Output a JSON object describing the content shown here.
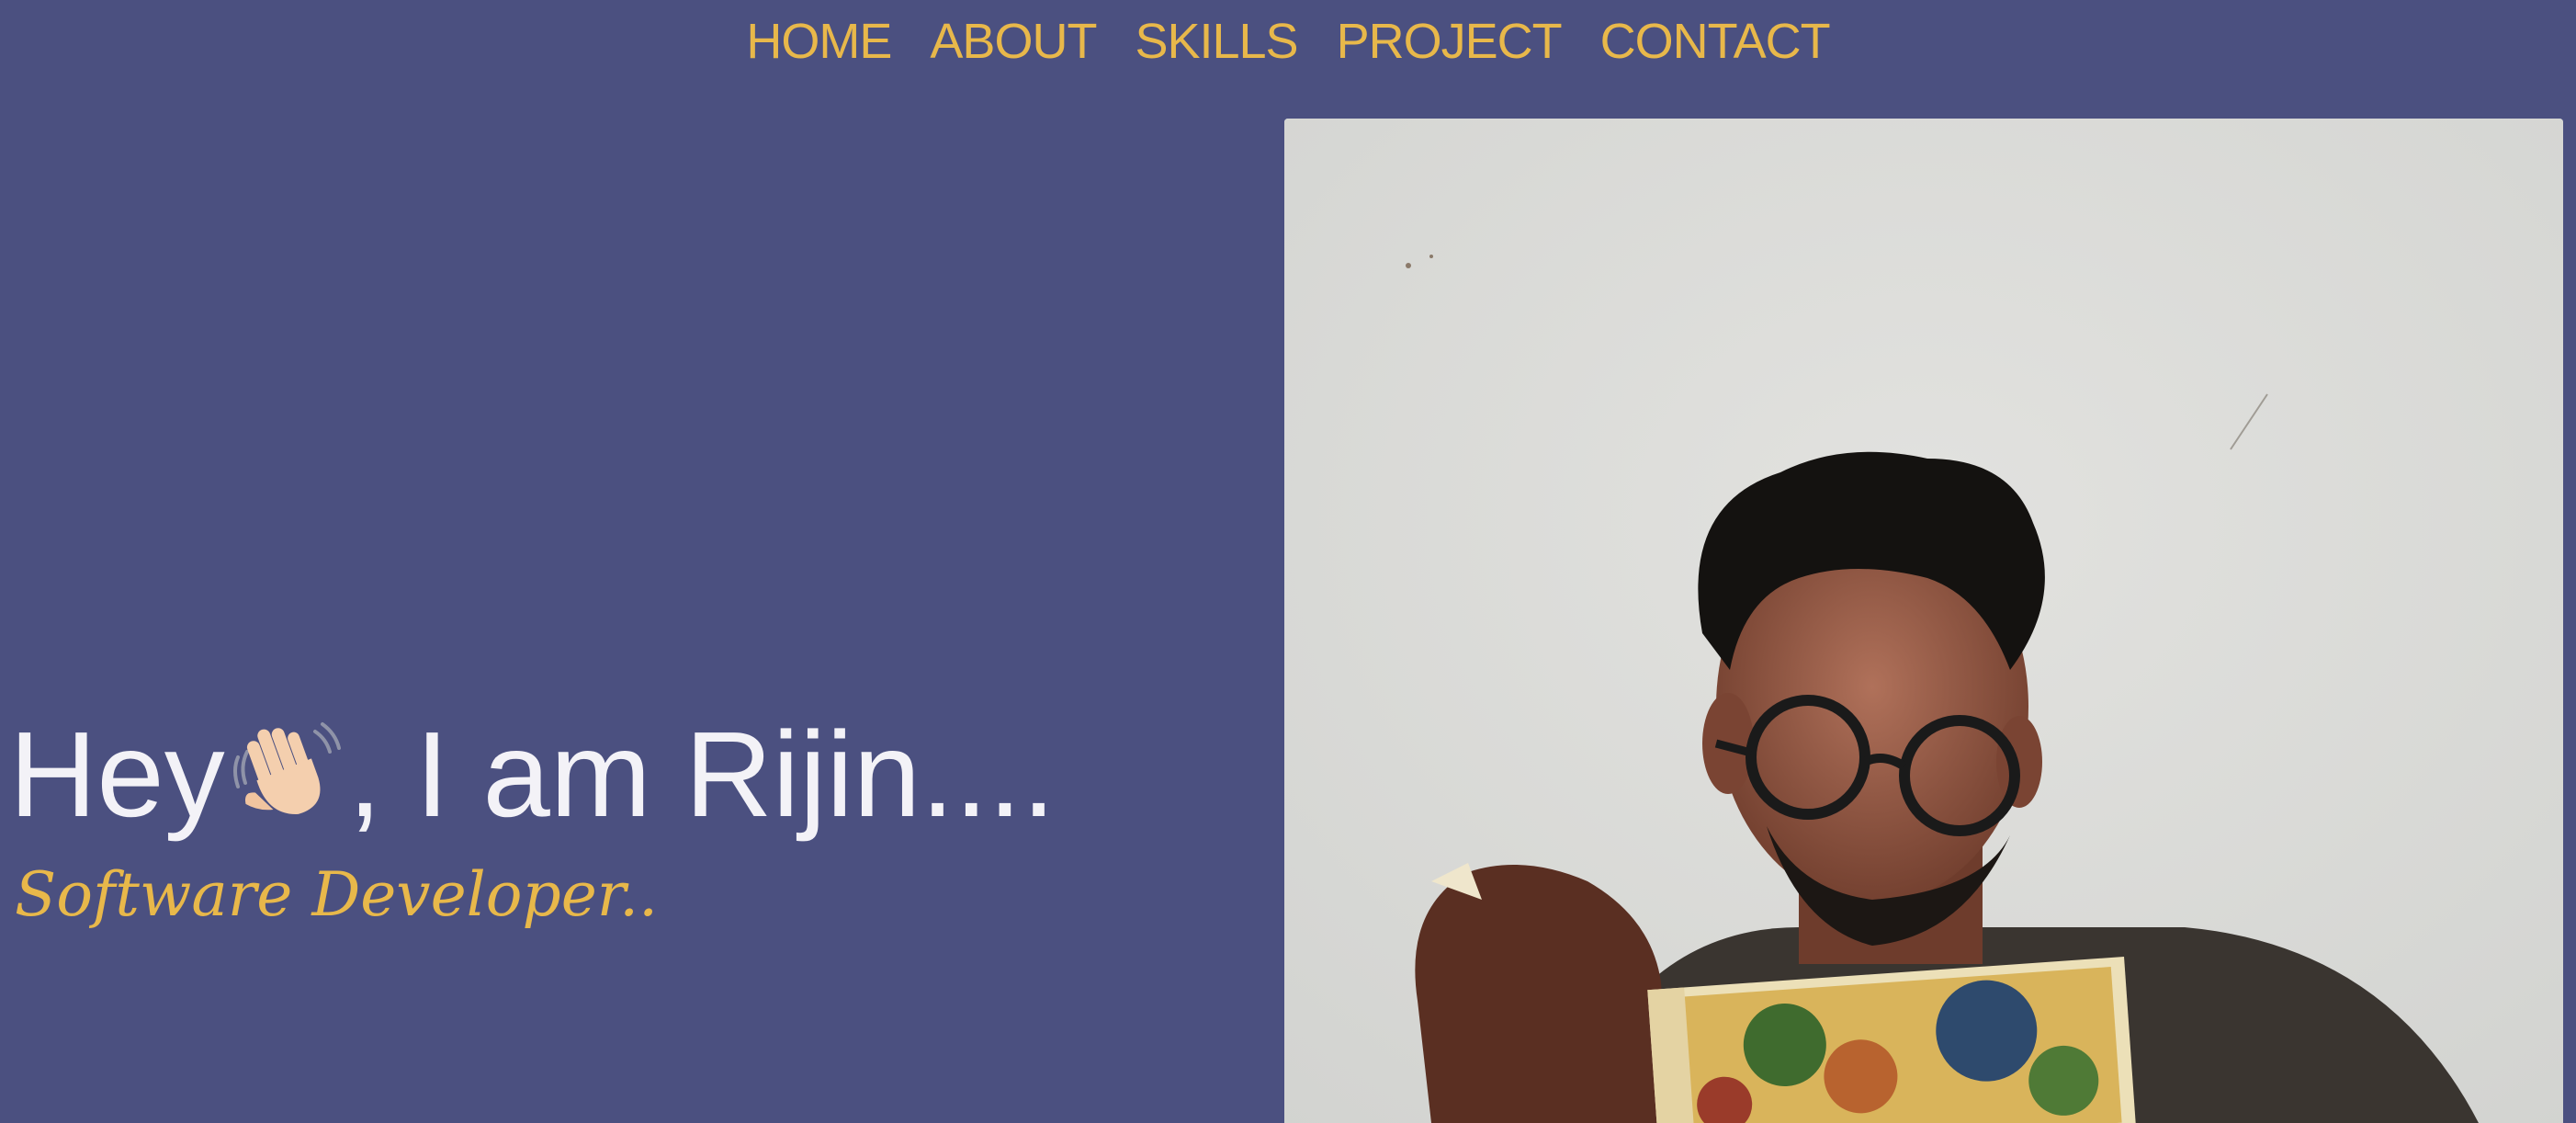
{
  "nav": {
    "items": [
      {
        "label": "HOME"
      },
      {
        "label": "ABOUT"
      },
      {
        "label": "SKILLS"
      },
      {
        "label": "PROJECT"
      },
      {
        "label": "CONTACT"
      }
    ]
  },
  "hero": {
    "greeting_prefix": "Hey",
    "greeting_icon": "waving-hand-icon",
    "greeting_suffix": ", I am Rijin....",
    "subtitle": "Software Developer.."
  },
  "photo": {
    "subject": "person-reading-book-photo"
  },
  "colors": {
    "background": "#4b5080",
    "accent": "#e8b84a",
    "heading": "#f3f2f7"
  }
}
